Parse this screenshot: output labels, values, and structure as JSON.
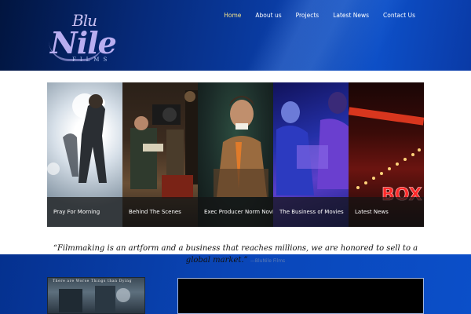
{
  "logo": {
    "line1": "Blu",
    "line2": "Nile",
    "line3": "FILMS"
  },
  "nav": {
    "items": [
      {
        "label": "Home",
        "active": true
      },
      {
        "label": "About us",
        "active": false
      },
      {
        "label": "Projects",
        "active": false
      },
      {
        "label": "Latest News",
        "active": false
      },
      {
        "label": "Contact Us",
        "active": false
      }
    ]
  },
  "slider": {
    "panels": [
      {
        "caption": "Pray For Morning"
      },
      {
        "caption": "Behind The Scenes"
      },
      {
        "caption": "Exec Producer Norm Novitsky"
      },
      {
        "caption": "The Business of Movies"
      },
      {
        "caption": "Latest News"
      }
    ]
  },
  "quote": {
    "text": "“Filmmaking is an artform and a business that reaches millions, we are honored to sell to a global market.”",
    "attribution": "—BluNile Films"
  },
  "poster": {
    "tagline": "There are Worse Things than Dying"
  },
  "colors": {
    "nav_active": "#f5e38a",
    "header_blue": "#0a3ea8",
    "band_blue": "#0a46b8"
  }
}
